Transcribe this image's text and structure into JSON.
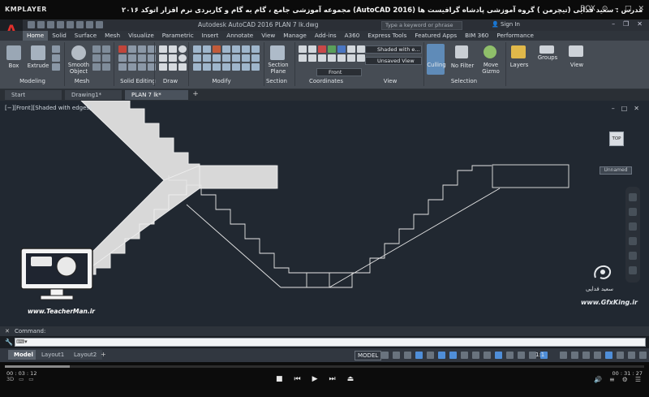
{
  "player": {
    "logo": "KMPLAYER",
    "title": "مجموعه آموزشی جامع ، گام به گام و کاربردی نرم افزار  اتوکد ۲۰۱۶ (AutoCAD 2016)   مدرس : سعید فدایی (تیچرمن ) گروه آموزشی پادشاه گرافیست ها",
    "box_label": "BOX",
    "time_current": "00 : 03 : 12",
    "time_total": "00 : 31 : 27",
    "progress": 0.102
  },
  "acad": {
    "logo": "A",
    "file_title": "Autodesk AutoCAD 2016    PLAN 7 lk.dwg",
    "search_placeholder": "Type a keyword or phrase",
    "signin": "Sign In",
    "tabs": [
      "Home",
      "Solid",
      "Surface",
      "Mesh",
      "Visualize",
      "Parametric",
      "Insert",
      "Annotate",
      "View",
      "Manage",
      "Add-ins",
      "A360",
      "Express Tools",
      "Featured Apps",
      "BIM 360",
      "Performance"
    ],
    "active_tab": "Home",
    "ribbon": {
      "box": "Box",
      "extrude": "Extrude",
      "smooth_object_1": "Smooth",
      "smooth_object_2": "Object",
      "section_plane_1": "Section",
      "section_plane_2": "Plane",
      "visual_style": "Shaded with e...",
      "saved_view": "Unsaved View",
      "view_dir": "Front",
      "culling": "Culling",
      "no_filter": "No Filter",
      "move_gizmo_1": "Move",
      "move_gizmo_2": "Gizmo",
      "layers": "Layers",
      "groups": "Groups",
      "view": "View",
      "panels": [
        "Modeling",
        "Mesh",
        "Solid Editing",
        "Draw",
        "Modify",
        "Section",
        "Coordinates",
        "View",
        "Selection"
      ]
    },
    "file_tabs": [
      "Start",
      "Drawing1*",
      "PLAN 7 lk*"
    ],
    "active_file_tab": "PLAN 7 lk*",
    "view_label": "[−][Front][Shaded with edges]",
    "viewcube_label": "TOP",
    "unnamed_label": "Unnamed",
    "command_label": "Command:",
    "command_prompt": "⌨▾",
    "layout_tabs": [
      "Model",
      "Layout1",
      "Layout2"
    ],
    "active_layout": "Model",
    "status_model": "MODEL",
    "scale": "1:1"
  },
  "watermark": {
    "teacherman_url": "www.TeacherMan.ir",
    "gfx_url": "www.GfxKing.ir",
    "gfx_name": "سعید فدایی"
  },
  "colors": {
    "canvas": "#212831",
    "ribbon": "#464c54",
    "stair_fill": "#d8d8d8",
    "line": "#e6e6e6"
  }
}
